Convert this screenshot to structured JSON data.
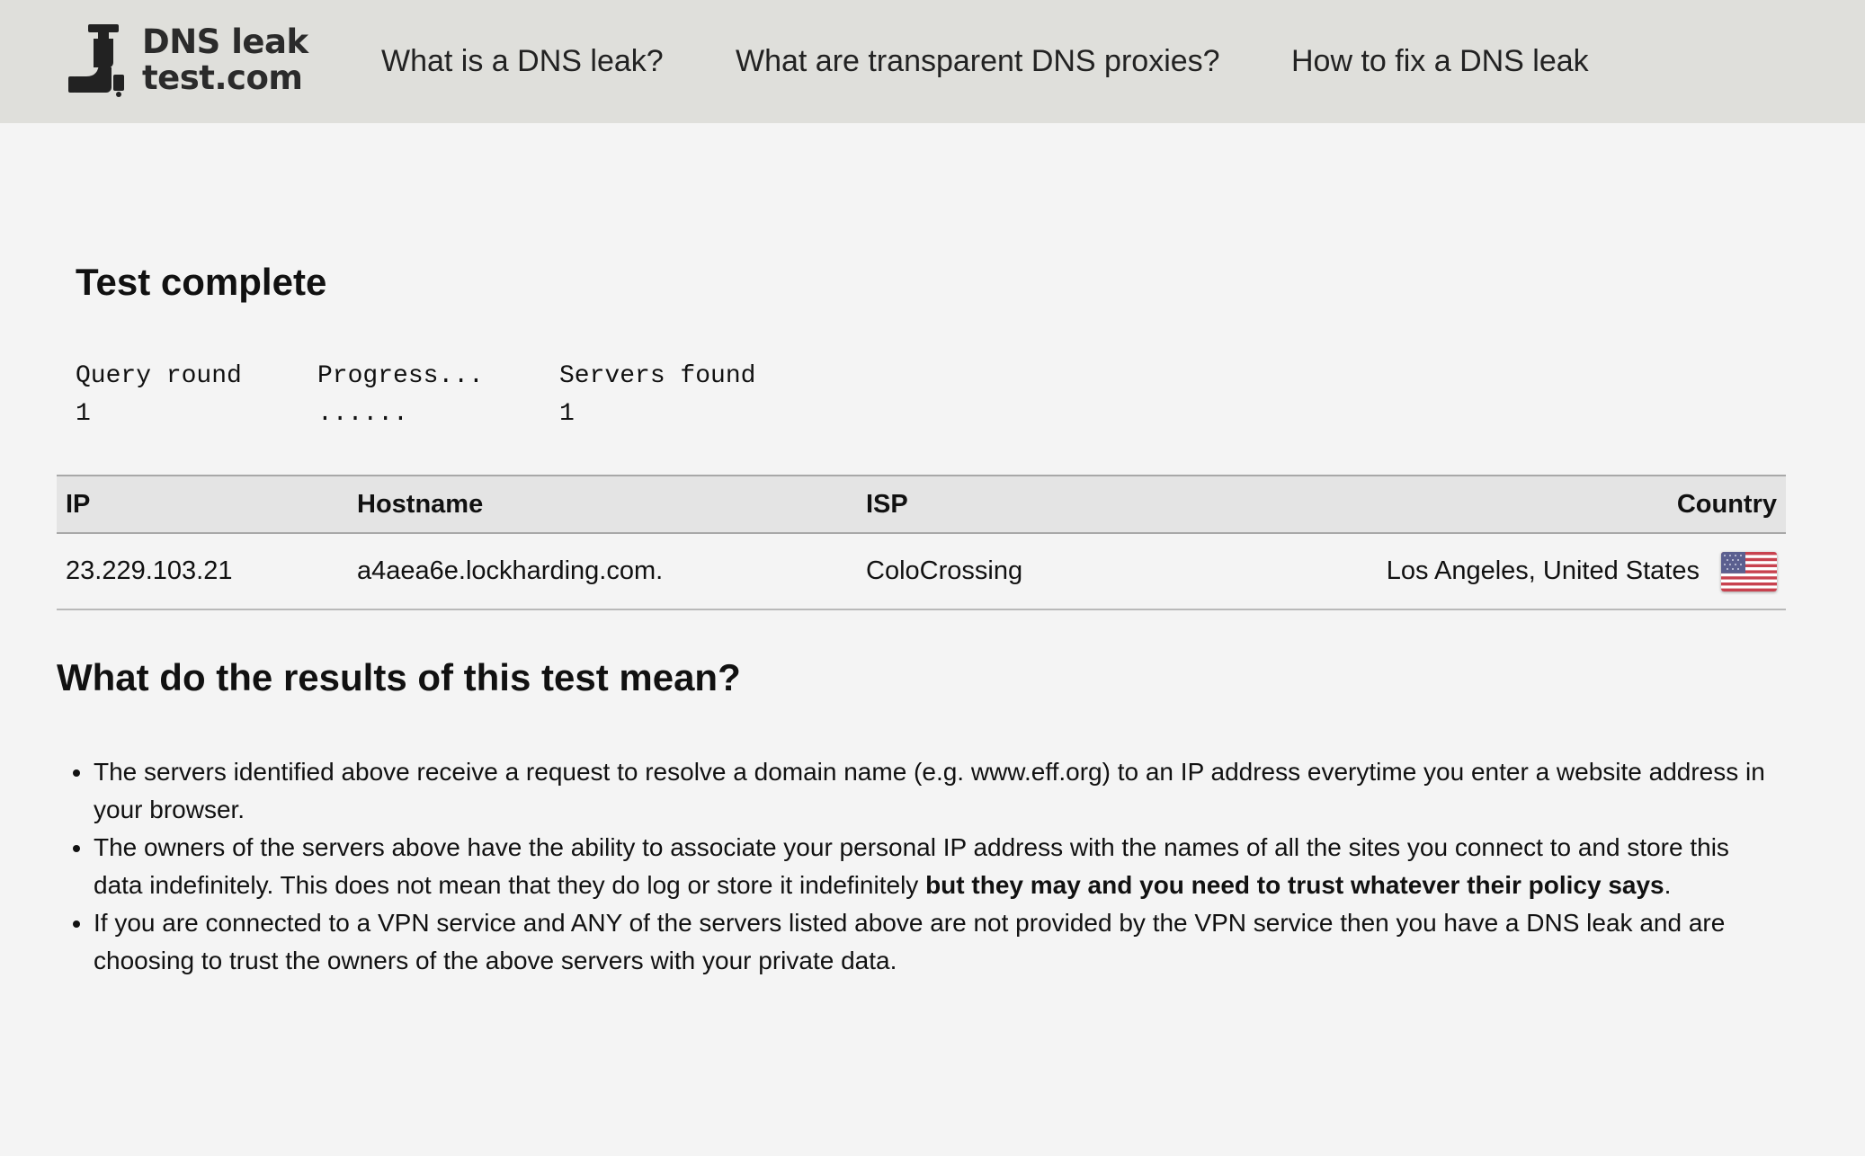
{
  "header": {
    "logo": {
      "line1": "DNS leak",
      "line2": "test.com"
    },
    "nav": [
      "What is a DNS leak?",
      "What are transparent DNS proxies?",
      "How to fix a DNS leak"
    ]
  },
  "status": {
    "title": "Test complete"
  },
  "stats": {
    "query_round": {
      "label": "Query round",
      "value": "1"
    },
    "progress": {
      "label": "Progress...",
      "value": "......"
    },
    "servers_found": {
      "label": "Servers found",
      "value": "1"
    }
  },
  "table": {
    "headers": [
      "IP",
      "Hostname",
      "ISP",
      "Country"
    ],
    "rows": [
      {
        "ip": "23.229.103.21",
        "hostname": "a4aea6e.lockharding.com.",
        "isp": "ColoCrossing",
        "country": "Los Angeles, United States",
        "flag_icon": "us-flag-icon"
      }
    ]
  },
  "explanation": {
    "heading": "What do the results of this test mean?",
    "bullets": [
      {
        "text": "The servers identified above receive a request to resolve a domain name (e.g. www.eff.org) to an IP address everytime you enter a website address in your browser."
      },
      {
        "text": "The owners of the servers above have the ability to associate your personal IP address with the names of all the sites you connect to and store this data indefinitely. This does not mean that they do log or store it indefinitely ",
        "bold": "but they may and you need to trust whatever their policy says",
        "end": "."
      },
      {
        "text": "If you are connected to a VPN service and ANY of the servers listed above are not provided by the VPN service then you have a DNS leak and are choosing to trust the owners of the above servers with your private data."
      }
    ]
  },
  "colors": {
    "header_bg": "#dfdfdb",
    "page_bg": "#f4f4f4",
    "table_header_bg": "#e4e4e4"
  }
}
